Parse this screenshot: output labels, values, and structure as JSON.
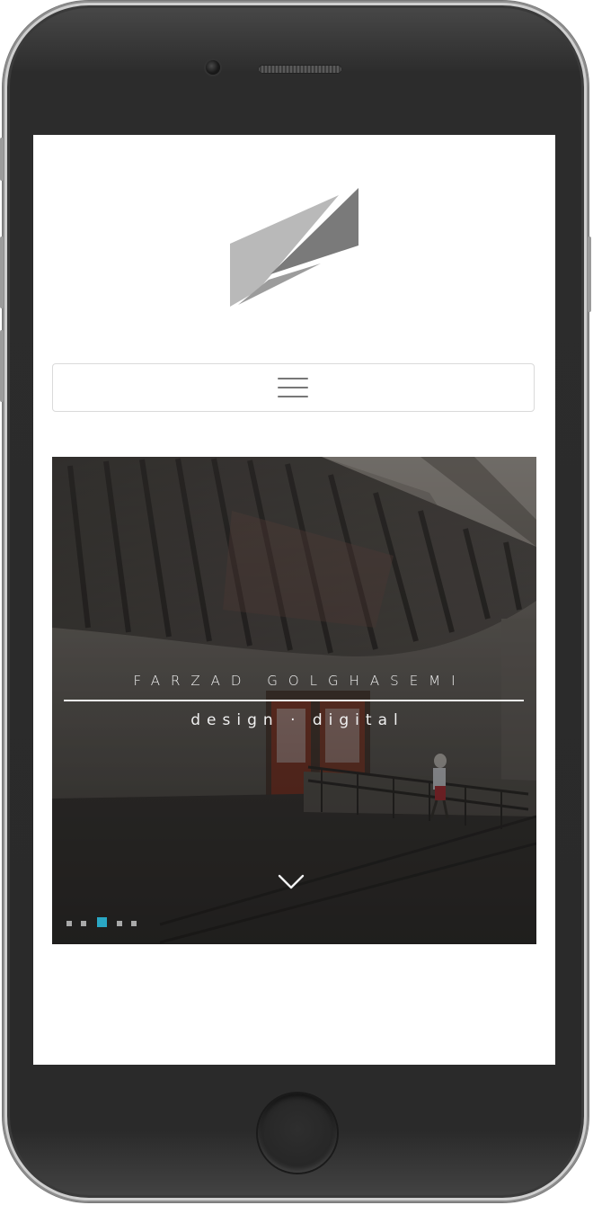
{
  "device": {
    "type": "smartphone",
    "frame_color": "#2a2a2a"
  },
  "site": {
    "logo_icon": "folded-parallelogram-logo-icon",
    "logo_colors": {
      "light": "#b9b9b9",
      "dark": "#7a7a7a"
    }
  },
  "navbar": {
    "menu_icon": "hamburger-menu-icon"
  },
  "hero": {
    "title": "FARZAD GOLGHASEMI",
    "subtitle": "design · digital",
    "scroll_icon": "chevron-down-icon",
    "slides_total": 5,
    "active_slide": 3,
    "active_dot_color": "#2aa7c4"
  }
}
